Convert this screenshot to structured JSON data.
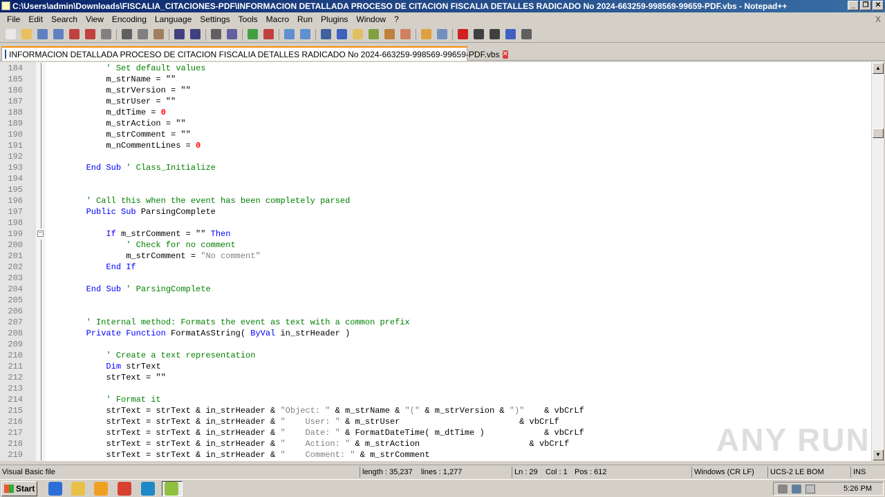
{
  "window": {
    "title": "C:\\Users\\admin\\Downloads\\FISCALIA_CITACIONES-PDF\\INFORMACION DETALLADA PROCESO DE CITACION FISCALIA DETALLES RADICADO No 2024-663259-998569-99659-PDF.vbs - Notepad++",
    "minimize": "_",
    "restore": "❐",
    "close": "✕"
  },
  "menu": {
    "items": [
      "File",
      "Edit",
      "Search",
      "View",
      "Encoding",
      "Language",
      "Settings",
      "Tools",
      "Macro",
      "Run",
      "Plugins",
      "Window",
      "?"
    ],
    "close_label": "X"
  },
  "toolbar": {
    "icons": [
      "new-file-icon",
      "open-file-icon",
      "save-icon",
      "save-all-icon",
      "close-icon",
      "close-all-icon",
      "print-icon",
      "cut-icon",
      "copy-icon",
      "paste-icon",
      "undo-icon",
      "redo-icon",
      "find-icon",
      "replace-icon",
      "zoom-in-icon",
      "zoom-out-icon",
      "sync-v-icon",
      "sync-h-icon",
      "word-wrap-icon",
      "show-all-chars-icon",
      "indent-guide-icon",
      "user-lang-icon",
      "doc-map-icon",
      "function-list-icon",
      "folder-workspace-icon",
      "monitor-icon",
      "record-macro-icon",
      "stop-record-icon",
      "play-macro-icon",
      "run-macro-multiple-icon",
      "save-macro-icon"
    ],
    "colors": [
      "#e8e8e8",
      "#e8c060",
      "#6080c0",
      "#6080c0",
      "#c04040",
      "#c04040",
      "#808080",
      "#606060",
      "#808080",
      "#a08060",
      "#404080",
      "#404080",
      "#606060",
      "#6060a0",
      "#40a040",
      "#c04040",
      "#6090d0",
      "#6090d0",
      "#4060a0",
      "#4060c0",
      "#e0c060",
      "#80a040",
      "#c08040",
      "#d08060",
      "#e0a040",
      "#7090c0",
      "#d02020",
      "#404040",
      "#404040",
      "#4060c0",
      "#606060"
    ]
  },
  "tab": {
    "label": "INFORMACION DETALLADA PROCESO DE CITACION FISCALIA DETALLES RADICADO No 2024-663259-998569-99659-PDF.vbs",
    "close": "✕"
  },
  "editor": {
    "lines": [
      {
        "n": "184",
        "segs": [
          [
            "            ",
            ""
          ],
          [
            "' Set default values",
            "cm"
          ]
        ]
      },
      {
        "n": "185",
        "segs": [
          [
            "            m_strName = \"\"",
            ""
          ]
        ]
      },
      {
        "n": "186",
        "segs": [
          [
            "            m_strVersion = \"\"",
            ""
          ]
        ]
      },
      {
        "n": "187",
        "segs": [
          [
            "            m_strUser = \"\"",
            ""
          ]
        ]
      },
      {
        "n": "188",
        "segs": [
          [
            "            m_dtTime = ",
            ""
          ],
          [
            "0",
            "num"
          ]
        ]
      },
      {
        "n": "189",
        "segs": [
          [
            "            m_strAction = \"\"",
            ""
          ]
        ]
      },
      {
        "n": "190",
        "segs": [
          [
            "            m_strComment = \"\"",
            ""
          ]
        ]
      },
      {
        "n": "191",
        "segs": [
          [
            "            m_nCommentLines = ",
            ""
          ],
          [
            "0",
            "num"
          ]
        ]
      },
      {
        "n": "192",
        "segs": [
          [
            "",
            ""
          ]
        ]
      },
      {
        "n": "193",
        "segs": [
          [
            "        ",
            ""
          ],
          [
            "End Sub",
            "kw"
          ],
          [
            " ",
            ""
          ],
          [
            "' Class_Initialize",
            "cm"
          ]
        ]
      },
      {
        "n": "194",
        "segs": [
          [
            "",
            ""
          ]
        ]
      },
      {
        "n": "195",
        "segs": [
          [
            "",
            ""
          ]
        ]
      },
      {
        "n": "196",
        "segs": [
          [
            "        ",
            ""
          ],
          [
            "' Call this when the event has been completely parsed",
            "cm"
          ]
        ]
      },
      {
        "n": "197",
        "segs": [
          [
            "        ",
            ""
          ],
          [
            "Public Sub",
            "kw"
          ],
          [
            " ParsingComplete",
            ""
          ]
        ]
      },
      {
        "n": "198",
        "segs": [
          [
            "",
            ""
          ]
        ]
      },
      {
        "n": "199",
        "segs": [
          [
            "            ",
            ""
          ],
          [
            "If",
            "kw"
          ],
          [
            " m_strComment = \"\" ",
            ""
          ],
          [
            "Then",
            "kw"
          ]
        ]
      },
      {
        "n": "200",
        "segs": [
          [
            "                ",
            ""
          ],
          [
            "' Check for no comment",
            "cm"
          ]
        ]
      },
      {
        "n": "201",
        "segs": [
          [
            "                m_strComment = ",
            ""
          ],
          [
            "\"No comment\"",
            "str"
          ]
        ]
      },
      {
        "n": "202",
        "segs": [
          [
            "            ",
            ""
          ],
          [
            "End If",
            "kw"
          ]
        ]
      },
      {
        "n": "203",
        "segs": [
          [
            "",
            ""
          ]
        ]
      },
      {
        "n": "204",
        "segs": [
          [
            "        ",
            ""
          ],
          [
            "End Sub",
            "kw"
          ],
          [
            " ",
            ""
          ],
          [
            "' ParsingComplete",
            "cm"
          ]
        ]
      },
      {
        "n": "205",
        "segs": [
          [
            "",
            ""
          ]
        ]
      },
      {
        "n": "206",
        "segs": [
          [
            "",
            ""
          ]
        ]
      },
      {
        "n": "207",
        "segs": [
          [
            "        ",
            ""
          ],
          [
            "' Internal method: Formats the event as text with a common prefix",
            "cm"
          ]
        ]
      },
      {
        "n": "208",
        "segs": [
          [
            "        ",
            ""
          ],
          [
            "Private Function",
            "kw"
          ],
          [
            " FormatAsString( ",
            ""
          ],
          [
            "ByVal",
            "kw"
          ],
          [
            " in_strHeader )",
            ""
          ]
        ]
      },
      {
        "n": "209",
        "segs": [
          [
            "",
            ""
          ]
        ]
      },
      {
        "n": "210",
        "segs": [
          [
            "            ",
            ""
          ],
          [
            "' Create a text representation",
            "cm"
          ]
        ]
      },
      {
        "n": "211",
        "segs": [
          [
            "            ",
            ""
          ],
          [
            "Dim",
            "kw"
          ],
          [
            " strText",
            ""
          ]
        ]
      },
      {
        "n": "212",
        "segs": [
          [
            "            strText = \"\"",
            ""
          ]
        ]
      },
      {
        "n": "213",
        "segs": [
          [
            "",
            ""
          ]
        ]
      },
      {
        "n": "214",
        "segs": [
          [
            "            ",
            ""
          ],
          [
            "' Format it",
            "cm"
          ]
        ]
      },
      {
        "n": "215",
        "segs": [
          [
            "            strText = strText & in_strHeader & ",
            ""
          ],
          [
            "\"Object: \"",
            "str"
          ],
          [
            " & m_strName & ",
            ""
          ],
          [
            "\"(\"",
            "str"
          ],
          [
            " & m_strVersion & ",
            ""
          ],
          [
            "\")\"",
            "str"
          ],
          [
            "    & vbCrLf",
            ""
          ]
        ]
      },
      {
        "n": "216",
        "segs": [
          [
            "            strText = strText & in_strHeader & ",
            ""
          ],
          [
            "\"    User: \"",
            "str"
          ],
          [
            " & m_strUser                        & vbCrLf",
            ""
          ]
        ]
      },
      {
        "n": "217",
        "segs": [
          [
            "            strText = strText & in_strHeader & ",
            ""
          ],
          [
            "\"    Date: \"",
            "str"
          ],
          [
            " & FormatDateTime( m_dtTime )            & vbCrLf",
            ""
          ]
        ]
      },
      {
        "n": "218",
        "segs": [
          [
            "            strText = strText & in_strHeader & ",
            ""
          ],
          [
            "\"    Action: \"",
            "str"
          ],
          [
            " & m_strAction                      & vbCrLf",
            ""
          ]
        ]
      },
      {
        "n": "219",
        "segs": [
          [
            "            strText = strText & in_strHeader & ",
            ""
          ],
          [
            "\"    Comment: \"",
            "str"
          ],
          [
            " & m_strComment",
            ""
          ]
        ]
      }
    ]
  },
  "status": {
    "language": "Visual Basic file",
    "length": "length : 35,237",
    "lines": "lines : 1,277",
    "ln": "Ln : 29",
    "col": "Col : 1",
    "pos": "Pos : 612",
    "eol": "Windows (CR LF)",
    "encoding": "UCS-2 LE BOM",
    "mode": "INS"
  },
  "taskbar": {
    "start": "Start",
    "clock": "5:26 PM",
    "icons": [
      {
        "name": "ie-icon",
        "color": "#2b6fd6"
      },
      {
        "name": "explorer-icon",
        "color": "#e8c048"
      },
      {
        "name": "media-player-icon",
        "color": "#f0a020"
      },
      {
        "name": "chrome-icon",
        "color": "#d84030"
      },
      {
        "name": "edge-icon",
        "color": "#1e88c8"
      },
      {
        "name": "notepadpp-icon",
        "color": "#90c040"
      }
    ]
  },
  "watermark": "ANY RUN"
}
